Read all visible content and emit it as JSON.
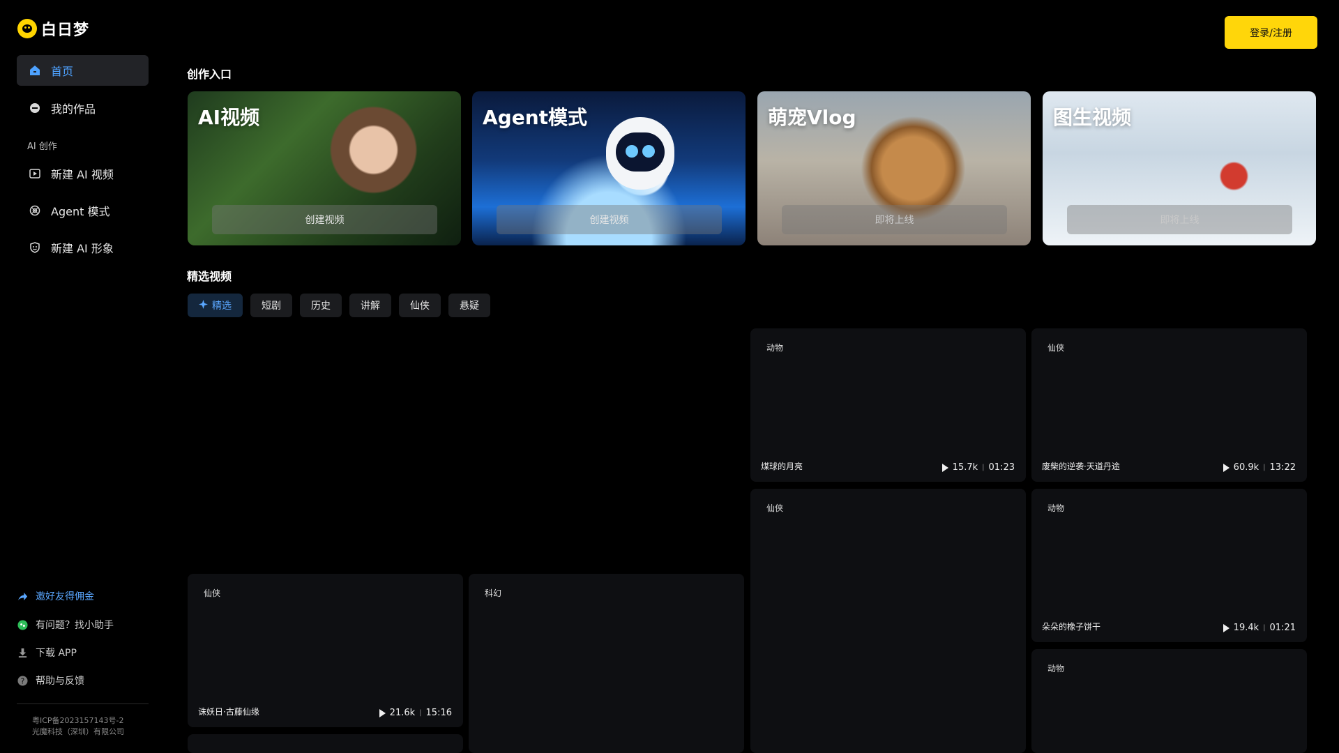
{
  "brand": {
    "name": "白日梦"
  },
  "header": {
    "login_label": "登录/注册"
  },
  "sidebar": {
    "items": [
      {
        "label": "首页",
        "icon": "home-icon"
      },
      {
        "label": "我的作品",
        "icon": "works-icon"
      }
    ],
    "section_label": "AI 创作",
    "create_items": [
      {
        "label": "新建 AI 视频",
        "icon": "video-icon"
      },
      {
        "label": "Agent 模式",
        "icon": "agent-icon"
      },
      {
        "label": "新建 AI 形象",
        "icon": "avatar-icon"
      }
    ],
    "bottom_links": [
      {
        "label": "邀好友得佣金",
        "icon": "share-icon"
      },
      {
        "label": "有问题？找小助手",
        "icon": "chat-icon"
      },
      {
        "label": "下载 APP",
        "icon": "download-icon"
      },
      {
        "label": "帮助与反馈",
        "icon": "help-icon"
      }
    ],
    "footer": {
      "icp": "粤ICP备2023157143号-2",
      "company": "光魔科技（深圳）有限公司"
    }
  },
  "creation": {
    "title": "创作入口",
    "cards": [
      {
        "title": "AI视频",
        "button": "创建视频"
      },
      {
        "title": "Agent模式",
        "button": "创建视频"
      },
      {
        "title": "萌宠Vlog",
        "button": "即将上线"
      },
      {
        "title": "图生视频",
        "button": "即将上线"
      }
    ]
  },
  "featured": {
    "title": "精选视频",
    "tabs": [
      "精选",
      "短剧",
      "历史",
      "讲解",
      "仙侠",
      "悬疑"
    ],
    "videos": [
      {
        "category": "动物",
        "title": "煤球的月亮",
        "views": "15.7k",
        "duration": "01:23"
      },
      {
        "category": "仙侠",
        "title": "废柴的逆袭·天道丹途",
        "views": "60.9k",
        "duration": "13:22"
      },
      {
        "category": "仙侠",
        "title": "",
        "views": "",
        "duration": ""
      },
      {
        "category": "动物",
        "title": "朵朵的橡子饼干",
        "views": "19.4k",
        "duration": "01:21"
      },
      {
        "category": "仙侠",
        "title": "诛妖日·古藤仙缘",
        "views": "21.6k",
        "duration": "15:16"
      },
      {
        "category": "科幻",
        "title": "",
        "views": "",
        "duration": ""
      },
      {
        "category": "动物",
        "title": "",
        "views": "",
        "duration": ""
      }
    ]
  }
}
